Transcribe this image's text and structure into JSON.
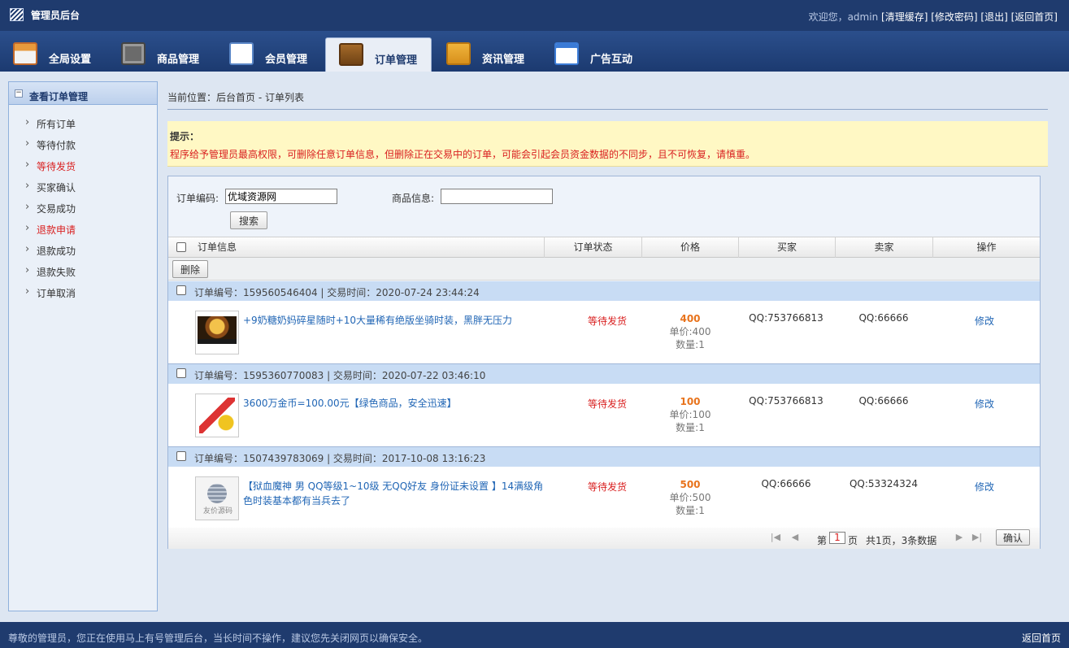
{
  "app": {
    "title": "管理员后台",
    "welcome": "欢迎您，admin",
    "links": [
      "[清理缓存]",
      "[修改密码]",
      "[退出]",
      "[返回首页]"
    ]
  },
  "nav": {
    "tabs": [
      {
        "label": "全局设置",
        "icon": "settings-icon"
      },
      {
        "label": "商品管理",
        "icon": "goods-icon"
      },
      {
        "label": "会员管理",
        "icon": "member-icon"
      },
      {
        "label": "订单管理",
        "icon": "wallet-icon",
        "active": true
      },
      {
        "label": "资讯管理",
        "icon": "news-icon"
      },
      {
        "label": "广告互动",
        "icon": "ad-icon"
      }
    ]
  },
  "sidebar": {
    "title": "查看订单管理",
    "items": [
      {
        "label": "所有订单"
      },
      {
        "label": "等待付款"
      },
      {
        "label": "等待发货",
        "highlight": true
      },
      {
        "label": "买家确认"
      },
      {
        "label": "交易成功"
      },
      {
        "label": "退款申请",
        "highlight": true
      },
      {
        "label": "退款成功"
      },
      {
        "label": "退款失败"
      },
      {
        "label": "订单取消"
      }
    ]
  },
  "breadcrumb": "当前位置：后台首页 - 订单列表",
  "notice": {
    "title": "提示：",
    "message": "程序给予管理员最高权限，可删除任意订单信息，但删除正在交易中的订单，可能会引起会员资金数据的不同步，且不可恢复，请慎重。"
  },
  "search": {
    "order_label": "订单编码:",
    "order_value": "优域资源网",
    "goods_label": "商品信息:",
    "goods_value": "",
    "button": "搜索"
  },
  "table": {
    "headers": [
      "订单信息",
      "订单状态",
      "价格",
      "买家",
      "卖家",
      "操作"
    ],
    "delete_button": "删除",
    "orders": [
      {
        "head": "订单编号：159560546404 | 交易时间：2020-07-24 23:44:24",
        "goods": "+9奶糖奶妈碎星随时+10大量稀有绝版坐骑时装，黑胖无压力",
        "status": "等待发货",
        "price": "400",
        "unit_price": "单价:400",
        "qty": "数量:1",
        "buyer": "QQ:753766813",
        "seller": "QQ:66666",
        "op": "修改"
      },
      {
        "head": "订单编号：1595360770083 | 交易时间：2020-07-22 03:46:10",
        "goods": "3600万金币=100.00元【绿色商品，安全迅速】",
        "status": "等待发货",
        "price": "100",
        "unit_price": "单价:100",
        "qty": "数量:1",
        "buyer": "QQ:753766813",
        "seller": "QQ:66666",
        "op": "修改"
      },
      {
        "head": "订单编号：1507439783069 | 交易时间：2017-10-08 13:16:23",
        "goods": "【狱血魔神 男 QQ等级1~10级 无QQ好友 身份证未设置 】14满级角色时装基本都有当兵去了",
        "status": "等待发货",
        "price": "500",
        "unit_price": "单价:500",
        "qty": "数量:1",
        "buyer": "QQ:66666",
        "seller": "QQ:53324324",
        "op": "修改",
        "thumb_label": "友价源码"
      }
    ]
  },
  "pager": {
    "prefix": "第",
    "page": "1",
    "suffix": "页",
    "summary": "共1页，3条数据",
    "confirm": "确认"
  },
  "footer": {
    "left": "尊敬的管理员，您正在使用马上有号管理后台，当长时间不操作，建议您先关闭网页以确保安全。",
    "right": "返回首页"
  }
}
